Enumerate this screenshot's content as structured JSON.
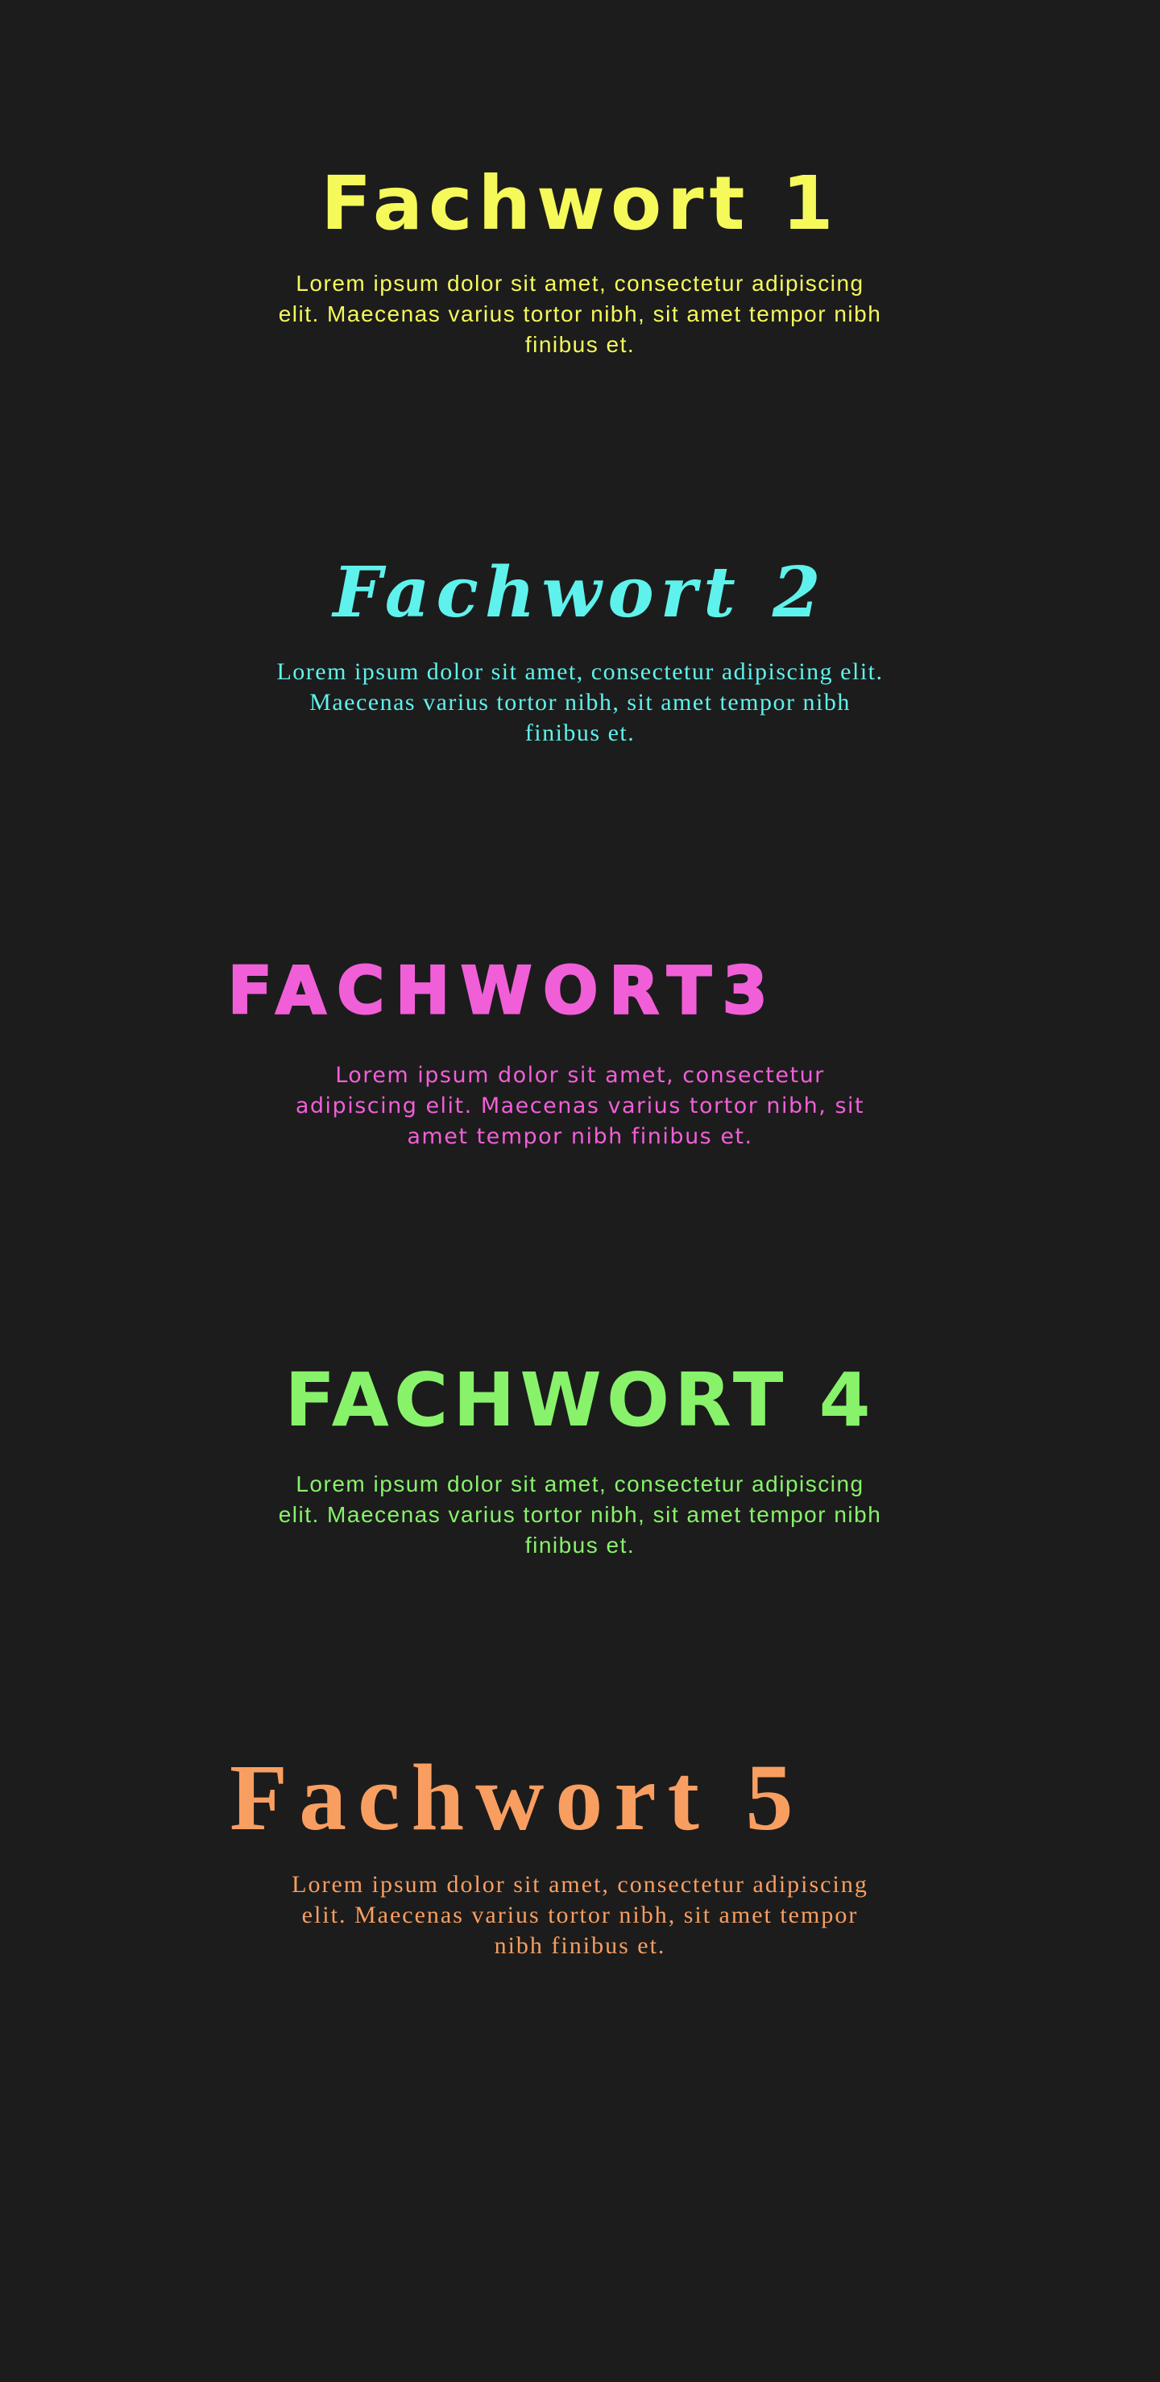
{
  "entries": [
    {
      "title": "Fachwort 1",
      "text": "Lorem ipsum dolor sit amet, consectetur adipiscing elit. Maecenas varius tortor nibh, sit amet tempor nibh finibus et.",
      "color": "#f5f95a"
    },
    {
      "title": "Fachwort 2",
      "text": "Lorem ipsum dolor sit amet, consectetur adipiscing elit. Maecenas varius tortor nibh, sit amet tempor nibh finibus et.",
      "color": "#5ff2ec"
    },
    {
      "title": "FACHWORT3",
      "text": "Lorem ipsum dolor sit amet, consectetur adipiscing elit. Maecenas varius tortor nibh, sit amet tempor nibh finibus et.",
      "color": "#f15fd8"
    },
    {
      "title": "FACHWORT 4",
      "text": "Lorem ipsum dolor sit amet, consectetur adipiscing elit. Maecenas varius tortor nibh, sit amet tempor nibh finibus et.",
      "color": "#88f26b"
    },
    {
      "title": "Fachwort 5",
      "text": "Lorem ipsum dolor sit amet, consectetur adipiscing elit. Maecenas varius tortor nibh, sit amet tempor nibh finibus et.",
      "color": "#f99e61"
    }
  ],
  "theme": {
    "background": "#1c1c1c"
  }
}
